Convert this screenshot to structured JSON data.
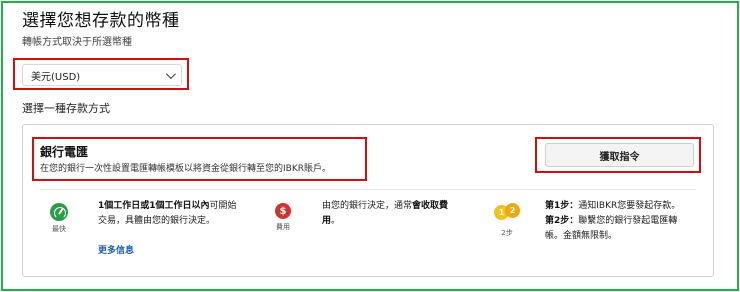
{
  "page": {
    "title": "選擇您想存款的幣種",
    "subtitle": "轉帳方式取決于所選幣種"
  },
  "currency_select": {
    "value": "美元(USD)"
  },
  "method_section": {
    "label": "選擇一種存款方式"
  },
  "wire_card": {
    "title": "銀行電匯",
    "description": "在您的銀行一次性設置電匯轉帳模板以將資金從銀行轉至您的IBKR賬戶。",
    "button_label": "獲取指令",
    "speed": {
      "caption": "最快",
      "text_bold": "1個工作日或1個工作日以內",
      "text_rest_1": "可開始",
      "text_line2": "交易，具體由您的銀行決定。"
    },
    "fee": {
      "icon_symbol": "$",
      "caption": "費用",
      "text_1": "由您的銀行決定，通常",
      "text_bold_1": "會收取費",
      "text_bold_2": "用",
      "text_2": "。"
    },
    "steps": {
      "icon_1": "1",
      "icon_2": "2",
      "caption": "2步",
      "step1_bold": "第1步：",
      "step1_text": "通知IBKR您要發起存款。",
      "step2_bold": "第2步：",
      "step2_text": "聯繫您的銀行發起電匯轉",
      "step2_line2": "帳。金額無限制。"
    },
    "more_link": "更多信息"
  },
  "colors": {
    "frame": "#22b04a",
    "highlight": "#d01010",
    "speed_icon": "#2a9d47",
    "fee_icon": "#d0322d",
    "steps_icon": "#f2c21b",
    "link": "#1f5fae"
  }
}
